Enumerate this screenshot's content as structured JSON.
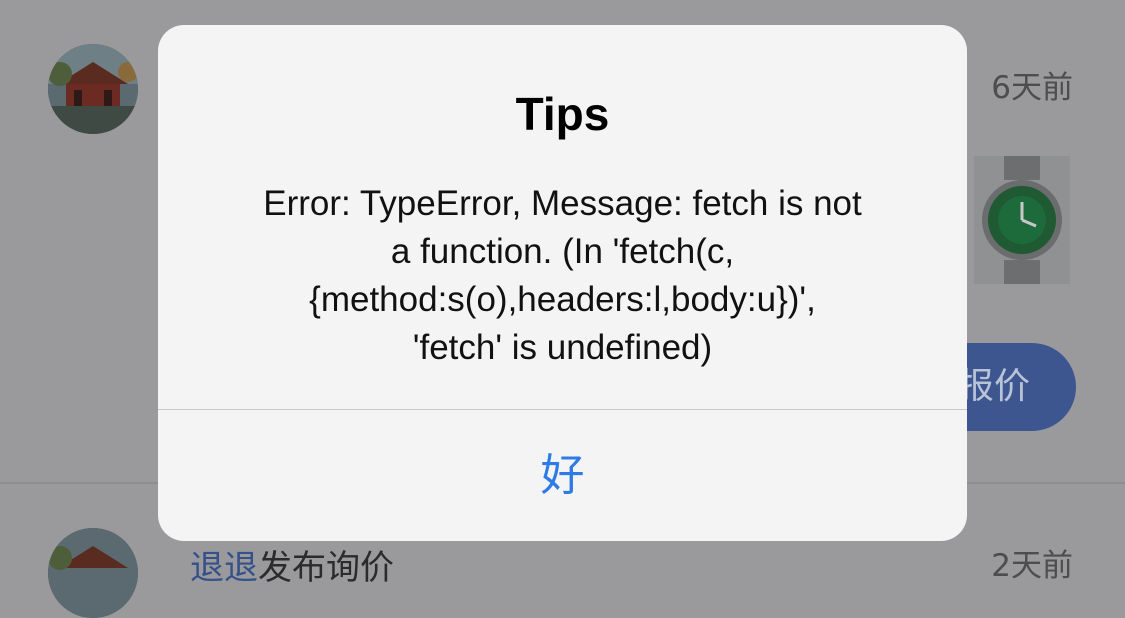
{
  "feed": {
    "items": [
      {
        "time": "6天前",
        "action_button": "报价"
      },
      {
        "user": "退退",
        "text": "发布询价",
        "time": "2天前"
      }
    ]
  },
  "alert": {
    "title": "Tips",
    "message": "Error: TypeError, Message: fetch is not\na function. (In 'fetch(c,\n{method:s(o),headers:l,body:u})',\n'fetch' is undefined)",
    "button_label": "好"
  },
  "colors": {
    "dimmed_background": "#9a9a9d",
    "alert_background": "#f4f4f5",
    "alert_button": "#2f7be5",
    "offer_button": "#3d568f"
  },
  "icons": {
    "avatar": "pagoda-photo-avatar",
    "product": "green-watch-thumbnail"
  }
}
